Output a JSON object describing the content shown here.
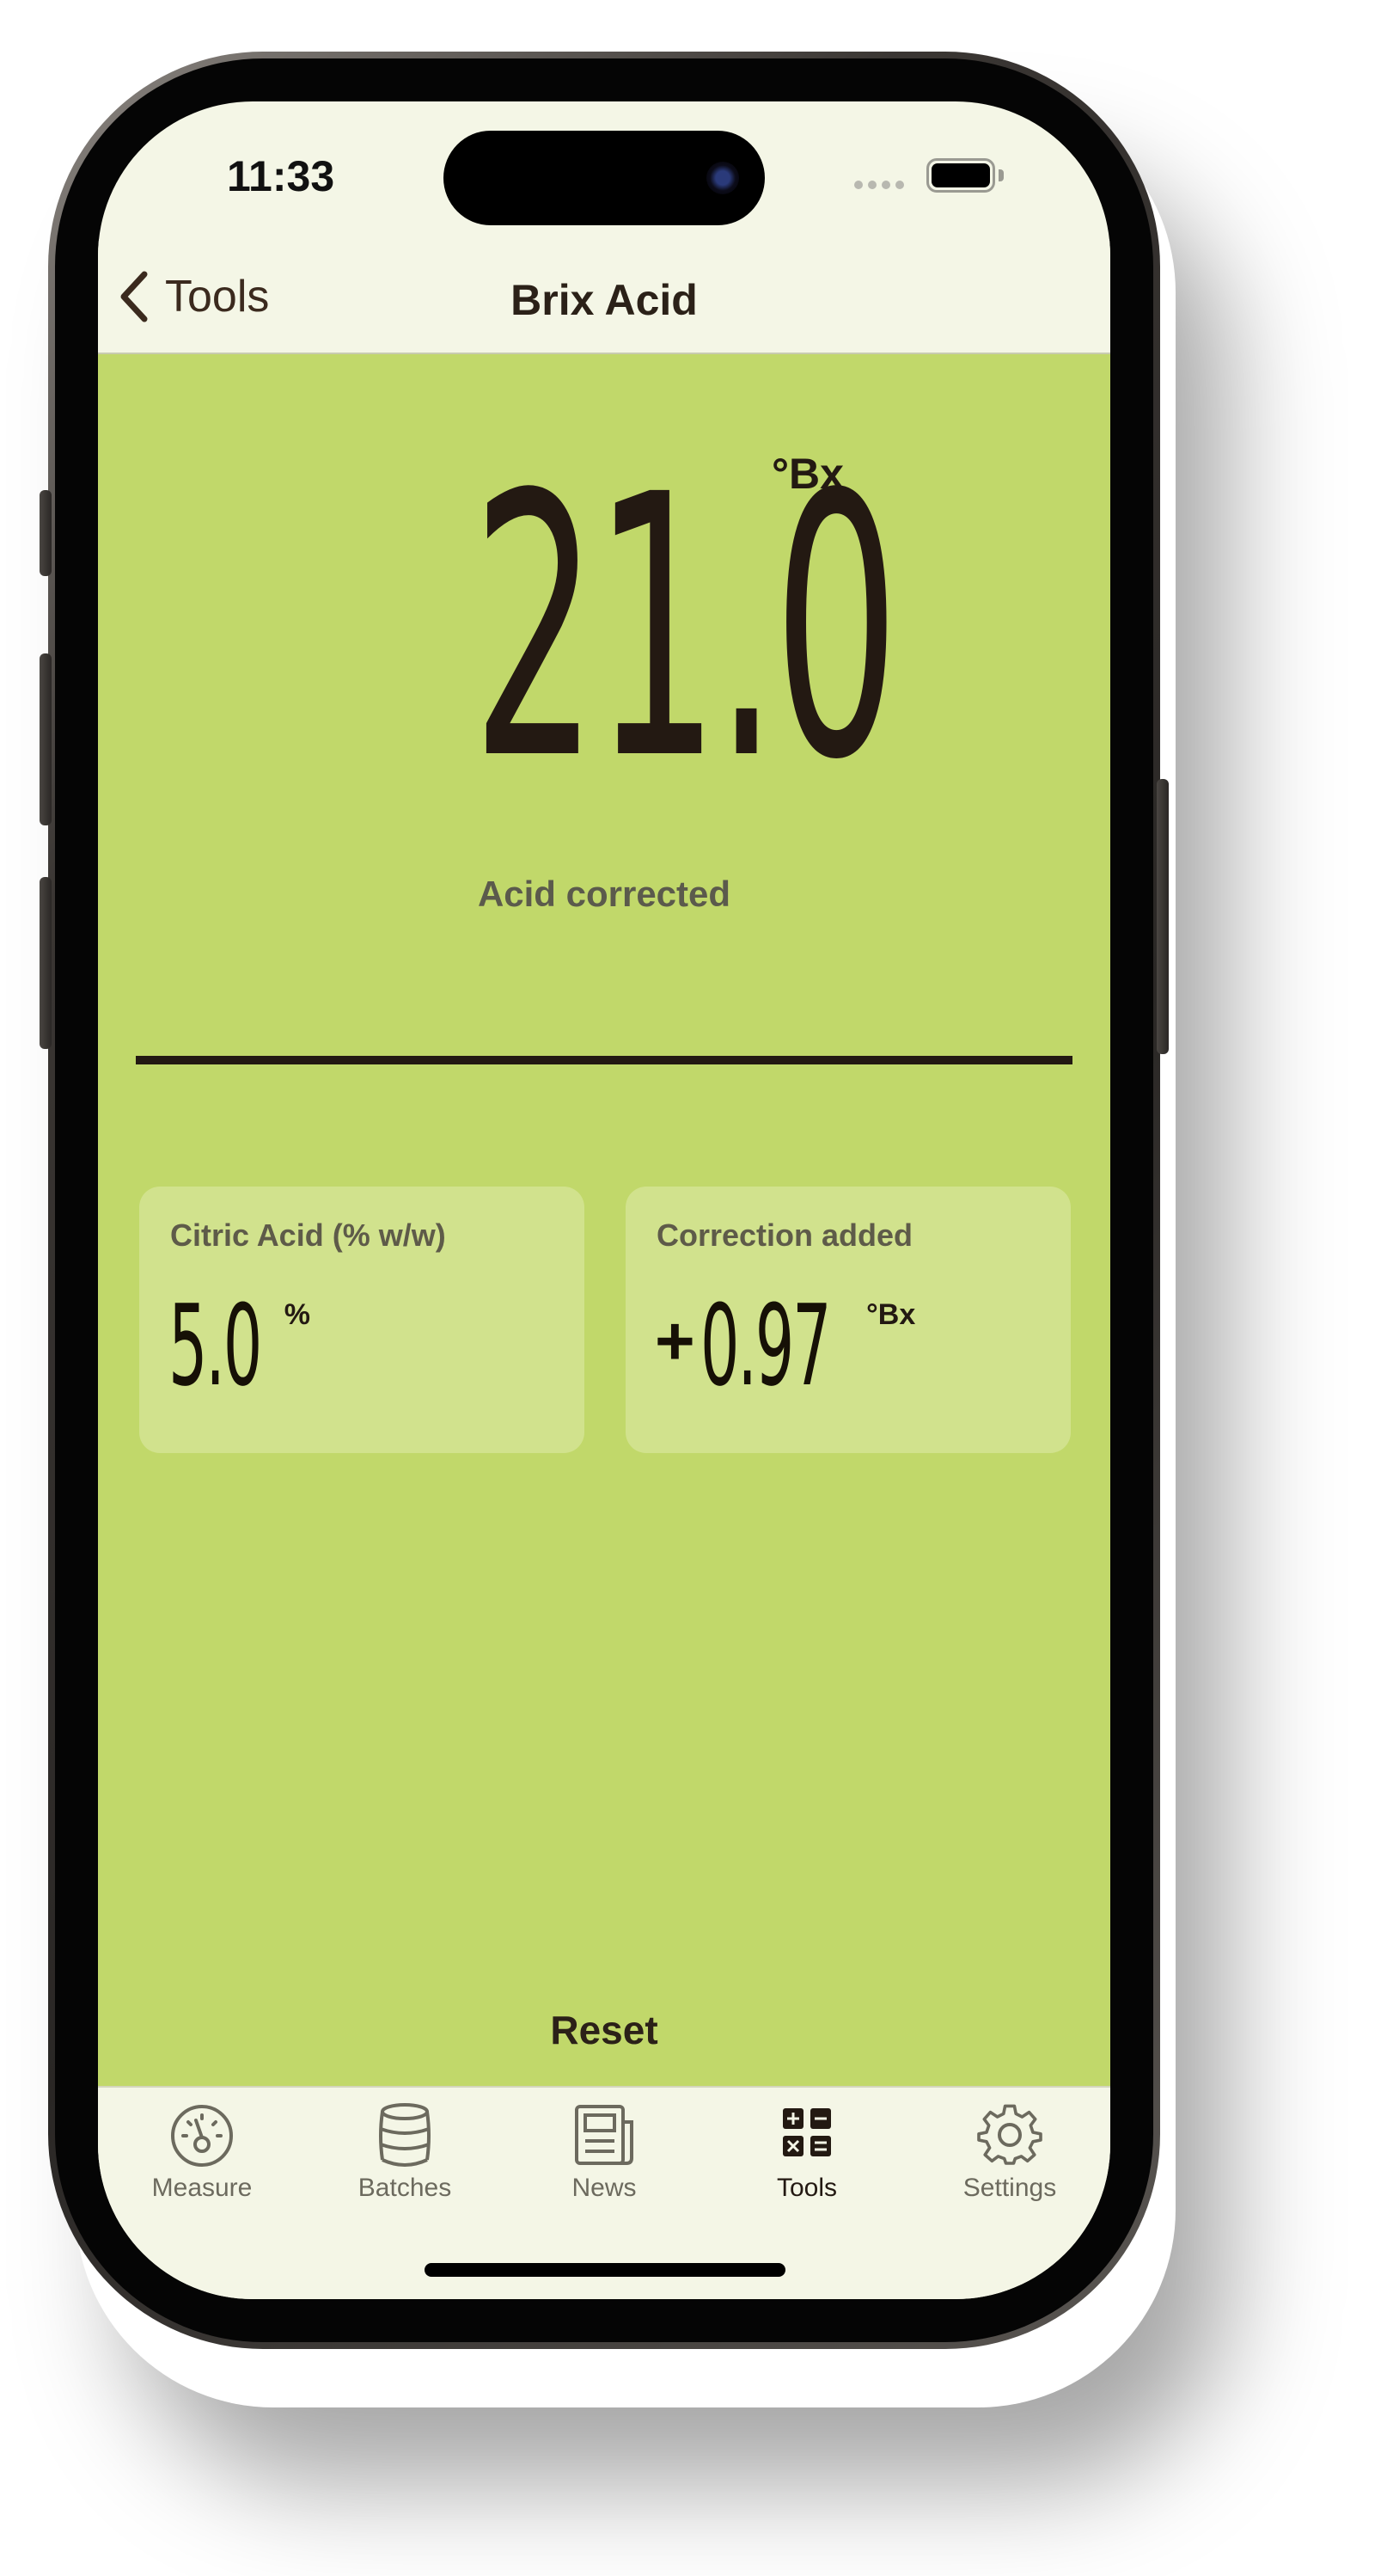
{
  "status_bar": {
    "time": "11:33"
  },
  "nav": {
    "back_label": "Tools",
    "title": "Brix Acid"
  },
  "reading": {
    "value": "21.0",
    "unit": "°Bx",
    "label": "Acid corrected"
  },
  "cards": [
    {
      "label": "Citric Acid (% w/w)",
      "prefix": "",
      "value": "5.0",
      "unit": "%"
    },
    {
      "label": "Correction added",
      "prefix": "+",
      "value": "0.97",
      "unit": "°Bx"
    }
  ],
  "reset_label": "Reset",
  "tabs": [
    {
      "label": "Measure",
      "icon": "gauge-icon",
      "active": false
    },
    {
      "label": "Batches",
      "icon": "barrel-icon",
      "active": false
    },
    {
      "label": "News",
      "icon": "newspaper-icon",
      "active": false
    },
    {
      "label": "Tools",
      "icon": "calculator-icon",
      "active": true
    },
    {
      "label": "Settings",
      "icon": "gear-icon",
      "active": false
    }
  ],
  "colors": {
    "content_background": "#C1D86A",
    "card_background": "#D1E28D",
    "chrome_background": "#F4F6E6",
    "text_dark": "#231912",
    "text_muted": "#5e5b49"
  }
}
